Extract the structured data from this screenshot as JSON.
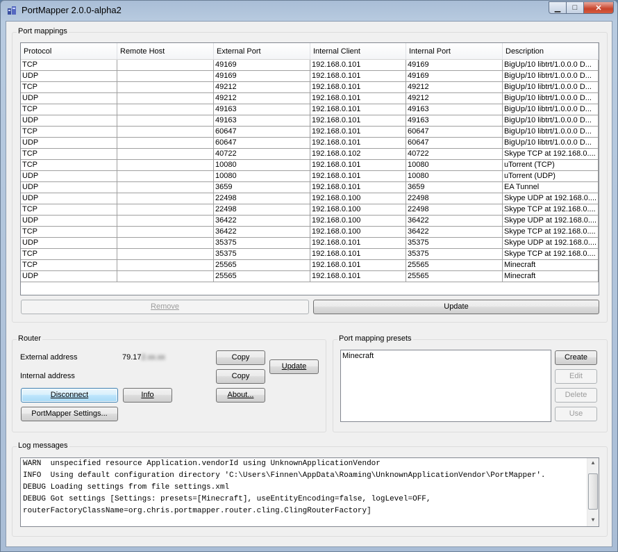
{
  "window": {
    "title": "PortMapper 2.0.0-alpha2",
    "minimize_label": "▁",
    "maximize_label": "□",
    "close_label": "✕"
  },
  "port_mappings": {
    "group_title": "Port mappings",
    "columns": [
      "Protocol",
      "Remote Host",
      "External Port",
      "Internal Client",
      "Internal Port",
      "Description"
    ],
    "rows": [
      [
        "TCP",
        "",
        "49169",
        "192.168.0.101",
        "49169",
        "BigUp/10 libtrt/1.0.0.0 D..."
      ],
      [
        "UDP",
        "",
        "49169",
        "192.168.0.101",
        "49169",
        "BigUp/10 libtrt/1.0.0.0 D..."
      ],
      [
        "TCP",
        "",
        "49212",
        "192.168.0.101",
        "49212",
        "BigUp/10 libtrt/1.0.0.0 D..."
      ],
      [
        "UDP",
        "",
        "49212",
        "192.168.0.101",
        "49212",
        "BigUp/10 libtrt/1.0.0.0 D..."
      ],
      [
        "TCP",
        "",
        "49163",
        "192.168.0.101",
        "49163",
        "BigUp/10 libtrt/1.0.0.0 D..."
      ],
      [
        "UDP",
        "",
        "49163",
        "192.168.0.101",
        "49163",
        "BigUp/10 libtrt/1.0.0.0 D..."
      ],
      [
        "TCP",
        "",
        "60647",
        "192.168.0.101",
        "60647",
        "BigUp/10 libtrt/1.0.0.0 D..."
      ],
      [
        "UDP",
        "",
        "60647",
        "192.168.0.101",
        "60647",
        "BigUp/10 libtrt/1.0.0.0 D..."
      ],
      [
        "TCP",
        "",
        "40722",
        "192.168.0.102",
        "40722",
        "Skype TCP at 192.168.0...."
      ],
      [
        "TCP",
        "",
        "10080",
        "192.168.0.101",
        "10080",
        "uTorrent (TCP)"
      ],
      [
        "UDP",
        "",
        "10080",
        "192.168.0.101",
        "10080",
        "uTorrent (UDP)"
      ],
      [
        "UDP",
        "",
        "3659",
        "192.168.0.101",
        "3659",
        "EA Tunnel"
      ],
      [
        "UDP",
        "",
        "22498",
        "192.168.0.100",
        "22498",
        "Skype UDP at 192.168.0...."
      ],
      [
        "TCP",
        "",
        "22498",
        "192.168.0.100",
        "22498",
        "Skype TCP at 192.168.0...."
      ],
      [
        "UDP",
        "",
        "36422",
        "192.168.0.100",
        "36422",
        "Skype UDP at 192.168.0...."
      ],
      [
        "TCP",
        "",
        "36422",
        "192.168.0.100",
        "36422",
        "Skype TCP at 192.168.0...."
      ],
      [
        "UDP",
        "",
        "35375",
        "192.168.0.101",
        "35375",
        "Skype UDP at 192.168.0...."
      ],
      [
        "TCP",
        "",
        "35375",
        "192.168.0.101",
        "35375",
        "Skype TCP at 192.168.0...."
      ],
      [
        "TCP",
        "",
        "25565",
        "192.168.0.101",
        "25565",
        "Minecraft"
      ],
      [
        "UDP",
        "",
        "25565",
        "192.168.0.101",
        "25565",
        "Minecraft"
      ]
    ],
    "remove_label": "Remove",
    "update_label": "Update"
  },
  "router": {
    "group_title": "Router",
    "external_address_label": "External address",
    "external_address_value": "79.17",
    "external_address_blurred": "2.xx.xx",
    "internal_address_label": "Internal address",
    "copy_label": "Copy",
    "update_label": "Update",
    "disconnect_label": "Disconnect",
    "info_label": "Info",
    "about_label": "About...",
    "settings_label": "PortMapper Settings..."
  },
  "presets": {
    "group_title": "Port mapping presets",
    "items": [
      "Minecraft"
    ],
    "create_label": "Create",
    "edit_label": "Edit",
    "delete_label": "Delete",
    "use_label": "Use"
  },
  "log": {
    "group_title": "Log messages",
    "lines": [
      "WARN  unspecified resource Application.vendorId using UnknownApplicationVendor",
      "INFO  Using default configuration directory 'C:\\Users\\Finnen\\AppData\\Roaming\\UnknownApplicationVendor\\PortMapper'.",
      "DEBUG Loading settings from file settings.xml",
      "DEBUG Got settings [Settings: presets=[Minecraft], useEntityEncoding=false, logLevel=OFF,",
      "routerFactoryClassName=org.chris.portmapper.router.cling.ClingRouterFactory]"
    ]
  }
}
